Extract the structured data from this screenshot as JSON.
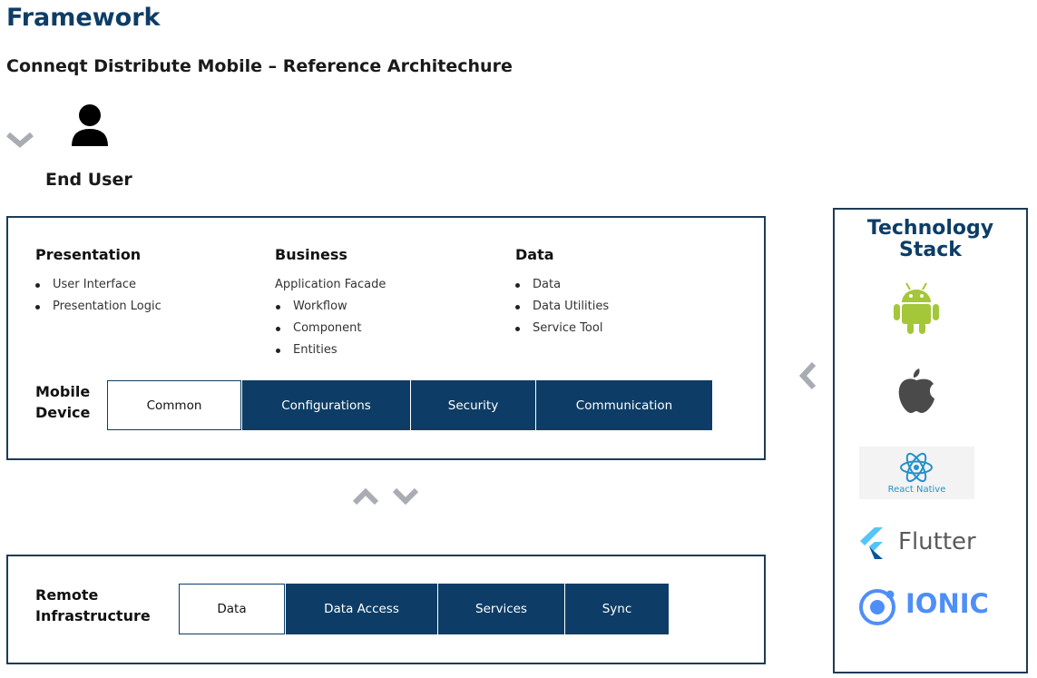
{
  "header": {
    "title": "Framework",
    "subtitle": "Conneqt Distribute Mobile – Reference Architechure"
  },
  "end_user": {
    "label": "End User",
    "icon": "user-icon"
  },
  "mobile": {
    "columns": [
      {
        "heading": "Presentation",
        "items": [
          "User Interface",
          "Presentation Logic"
        ],
        "lead": ""
      },
      {
        "heading": "Business",
        "lead": "Application Facade",
        "items": [
          "Workflow",
          "Component",
          "Entities"
        ]
      },
      {
        "heading": "Data",
        "items": [
          "Data",
          "Data Utilities",
          "Service Tool"
        ],
        "lead": ""
      }
    ],
    "label_line1": "Mobile",
    "label_line2": "Device",
    "segments": [
      "Common",
      "Configurations",
      "Security",
      "Communication"
    ]
  },
  "remote": {
    "label_line1": "Remote",
    "label_line2": "Infrastructure",
    "segments": [
      "Data",
      "Data Access",
      "Services",
      "Sync"
    ]
  },
  "tech_stack": {
    "title_line1": "Technology",
    "title_line2": "Stack",
    "items": {
      "android": "android-icon",
      "apple": "apple-icon",
      "react": "React Native",
      "flutter": "Flutter",
      "ionic": "IONIC"
    }
  },
  "colors": {
    "brand": "#0d3d66",
    "android": "#a4c639",
    "react": "#2790c9",
    "ionic": "#4e8ef7",
    "chevron": "#a9acb3"
  }
}
